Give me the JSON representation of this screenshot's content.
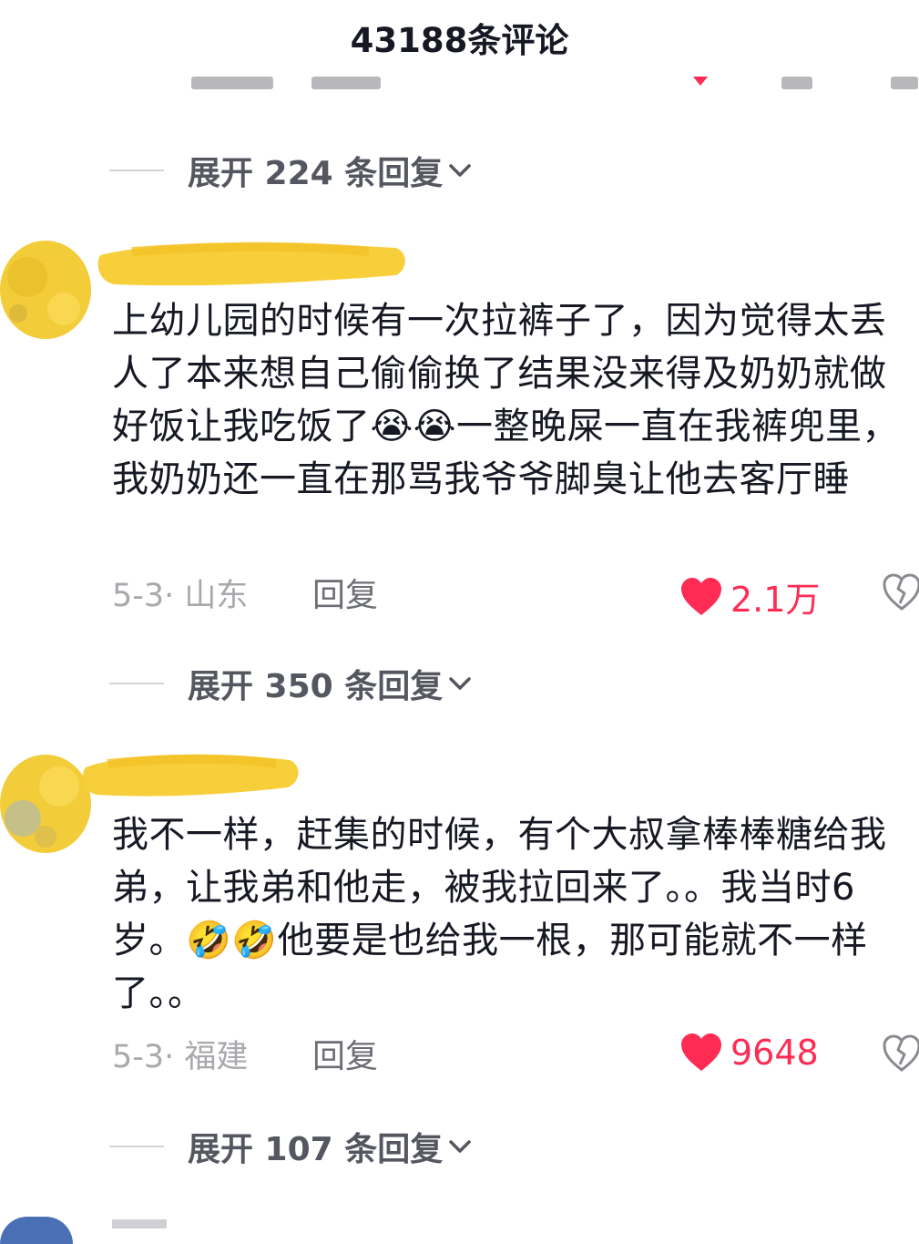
{
  "header": {
    "title": "43188条评论"
  },
  "threads": [
    {
      "expand_label": "展开 224 条回复"
    },
    {
      "text": "上幼儿园的时候有一次拉裤子了，因为觉得太丢人了本来想自己偷偷换了结果没来得及奶奶就做好饭让我吃饭了😭😭一整晚屎一直在我裤兜里，我奶奶还一直在那骂我爷爷脚臭让他去客厅睡",
      "date_location": "5-3· 山东",
      "reply_label": "回复",
      "likes": "2.1万",
      "expand_label": "展开 350 条回复"
    },
    {
      "text": "我不一样，赶集的时候，有个大叔拿棒棒糖给我弟，让我弟和他走，被我拉回来了。。我当时6岁。🤣🤣他要是也给我一根，那可能就不一样了。。",
      "date_location": "5-3· 福建",
      "reply_label": "回复",
      "likes": "9648",
      "expand_label": "展开 107 条回复"
    }
  ],
  "colors": {
    "like": "#fe2c55",
    "muted": "#a8a9ad",
    "text": "#161823",
    "name_censor": "#f7cf3a"
  },
  "icons": [
    "heart-icon",
    "broken-heart-icon",
    "chevron-down-icon"
  ]
}
